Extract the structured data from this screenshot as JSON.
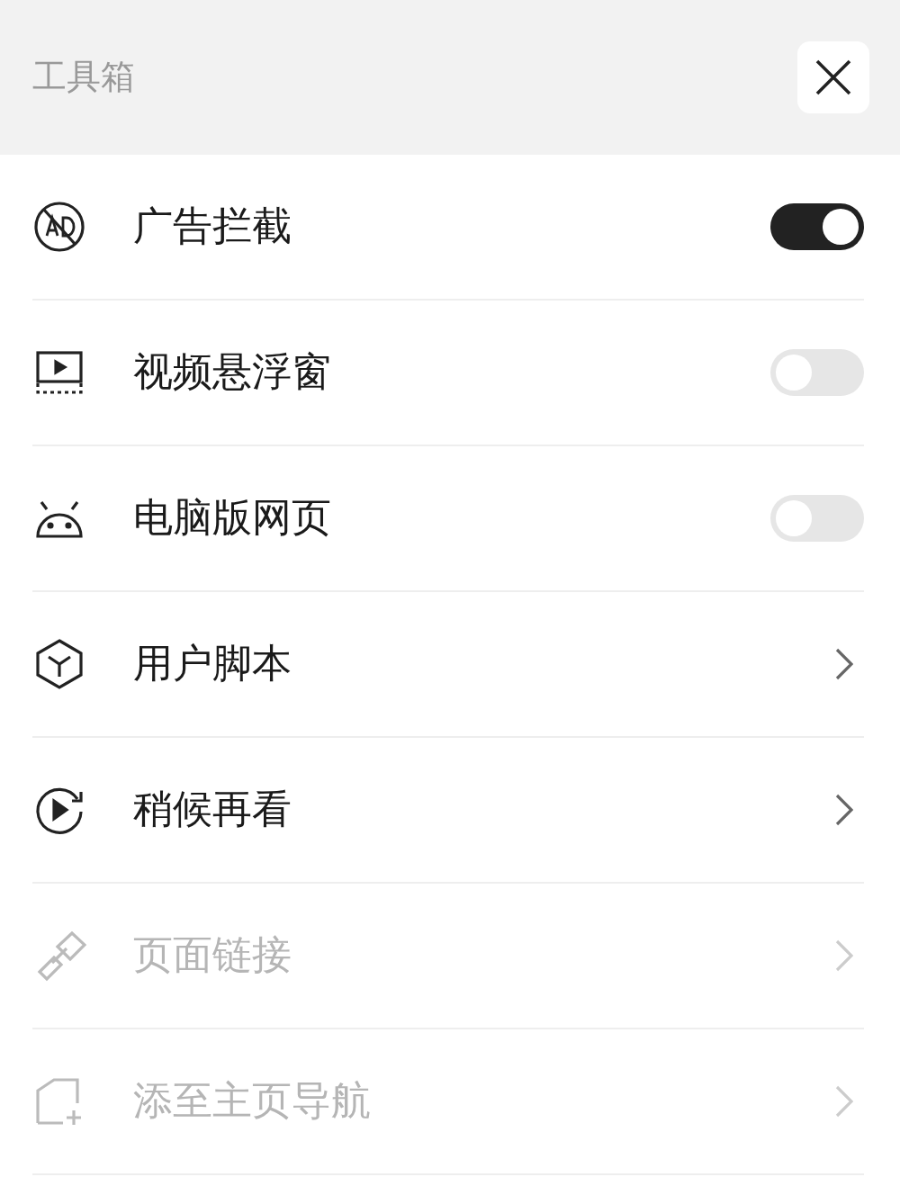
{
  "header": {
    "title": "工具箱"
  },
  "items": [
    {
      "label": "广告拦截",
      "kind": "toggle",
      "on": true,
      "disabled": false
    },
    {
      "label": "视频悬浮窗",
      "kind": "toggle",
      "on": false,
      "disabled": false
    },
    {
      "label": "电脑版网页",
      "kind": "toggle",
      "on": false,
      "disabled": false
    },
    {
      "label": "用户脚本",
      "kind": "link",
      "disabled": false
    },
    {
      "label": "稍候再看",
      "kind": "link",
      "disabled": false
    },
    {
      "label": "页面链接",
      "kind": "link",
      "disabled": true
    },
    {
      "label": "添至主页导航",
      "kind": "link",
      "disabled": true
    }
  ]
}
